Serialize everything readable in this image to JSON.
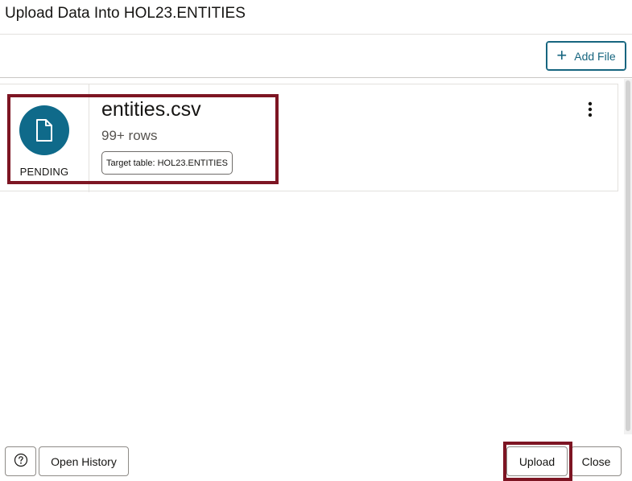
{
  "dialog": {
    "title": "Upload Data Into HOL23.ENTITIES"
  },
  "toolbar": {
    "add_file_label": "Add File",
    "add_file_icon": "plus-icon"
  },
  "file": {
    "name": "entities.csv",
    "rows": "99+ rows",
    "target_table": "Target table: HOL23.ENTITIES",
    "status": "PENDING",
    "icon": "document-icon",
    "menu_icon": "kebab-menu-icon"
  },
  "footer": {
    "help_icon": "question-circle-icon",
    "open_history_label": "Open History",
    "upload_label": "Upload",
    "close_label": "Close"
  },
  "colors": {
    "accent": "#16657f",
    "icon_circle": "#0f6a8a",
    "highlight": "#7d1523"
  }
}
